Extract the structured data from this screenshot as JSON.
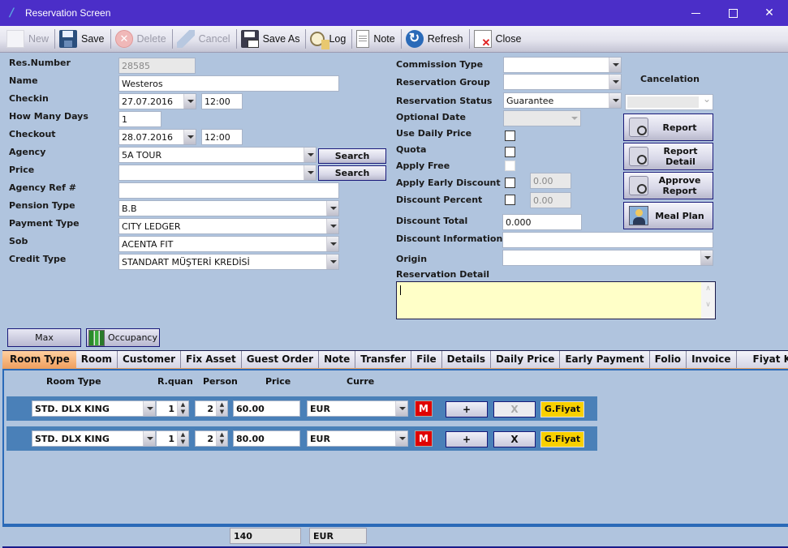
{
  "window": {
    "title": "Reservation Screen",
    "controls": {
      "minimize": "minimize",
      "maximize": "maximize",
      "close": "close"
    }
  },
  "toolbar": {
    "buttons": [
      {
        "label": "New",
        "icon": "new-document-icon",
        "enabled": false
      },
      {
        "label": "Save",
        "icon": "floppy-disk-icon",
        "enabled": true
      },
      {
        "label": "Delete",
        "icon": "delete-circle-icon",
        "enabled": false
      },
      {
        "label": "Cancel",
        "icon": "cancel-icon",
        "enabled": false
      },
      {
        "label": "Save As",
        "icon": "save-as-icon",
        "enabled": true
      },
      {
        "label": "Log",
        "icon": "clock-scroll-icon",
        "enabled": true
      },
      {
        "label": "Note",
        "icon": "notepad-icon",
        "enabled": true
      },
      {
        "label": "Refresh",
        "icon": "refresh-icon",
        "enabled": true
      },
      {
        "label": "Close",
        "icon": "close-window-icon",
        "enabled": true
      }
    ]
  },
  "left_form": {
    "res_number": {
      "label": "Res.Number",
      "value": "28585"
    },
    "name": {
      "label": "Name",
      "value": "Westeros"
    },
    "checkin": {
      "label": "Checkin",
      "date": "27.07.2016",
      "time": "12:00"
    },
    "how_many_days": {
      "label": "How Many Days",
      "value": "1"
    },
    "checkout": {
      "label": "Checkout",
      "date": "28.07.2016",
      "time": "12:00"
    },
    "agency": {
      "label": "Agency",
      "value": "5A TOUR",
      "search_label": "Search"
    },
    "price": {
      "label": "Price",
      "value": "",
      "search_label": "Search"
    },
    "agency_ref": {
      "label": "Agency Ref #",
      "value": ""
    },
    "pension_type": {
      "label": "Pension Type",
      "value": "B.B"
    },
    "payment_type": {
      "label": "Payment Type",
      "value": "CITY LEDGER"
    },
    "sob": {
      "label": "Sob",
      "value": "ACENTA FIT"
    },
    "credit_type": {
      "label": "Credit Type",
      "value": "STANDART MÜŞTERİ KREDİSİ"
    }
  },
  "right_form": {
    "commission_type": {
      "label": "Commission Type",
      "value": ""
    },
    "reservation_group": {
      "label": "Reservation Group",
      "value": ""
    },
    "reservation_status": {
      "label": "Reservation Status",
      "value": "Guarantee"
    },
    "cancelation": {
      "label": "Cancelation",
      "value": ""
    },
    "optional_date": {
      "label": "Optional Date",
      "value": ""
    },
    "use_daily_price": {
      "label": "Use Daily Price",
      "checked": false
    },
    "quota": {
      "label": "Quota",
      "checked": false
    },
    "apply_free": {
      "label": "Apply Free",
      "checked": false
    },
    "apply_early_discount": {
      "label": "Apply Early Discount",
      "checked": false,
      "value": "0.00"
    },
    "discount_percent": {
      "label": "Discount Percent",
      "checked": false,
      "value": "0.00"
    },
    "discount_total": {
      "label": "Discount Total",
      "value": "0.000"
    },
    "discount_information": {
      "label": "Discount Information",
      "value": ""
    },
    "origin": {
      "label": "Origin",
      "value": ""
    },
    "reservation_detail": {
      "label": "Reservation Detail",
      "value": ""
    }
  },
  "side_buttons": {
    "report": "Report",
    "report_detail": "Report Detail",
    "approve_report_line1": "Approve",
    "approve_report_line2": "Report",
    "meal_plan": "Meal Plan"
  },
  "under_buttons": {
    "max": "Max",
    "occupancy": "Occupancy"
  },
  "tabs": [
    {
      "label": "Room Type",
      "active": true
    },
    {
      "label": "Room"
    },
    {
      "label": "Customer"
    },
    {
      "label": "Fix Asset"
    },
    {
      "label": "Guest Order"
    },
    {
      "label": "Note"
    },
    {
      "label": "Transfer"
    },
    {
      "label": "File"
    },
    {
      "label": "Details"
    },
    {
      "label": "Daily Price"
    },
    {
      "label": "Early Payment"
    },
    {
      "label": "Folio"
    },
    {
      "label": "Invoice"
    },
    {
      "label": "Fiyat Kontrol"
    }
  ],
  "room_grid": {
    "columns": [
      "Room Type",
      "R.quan",
      "Person",
      "Price",
      "Curre"
    ],
    "rows": [
      {
        "room_type": "STD. DLX KING",
        "r_quan": "1",
        "person": "2",
        "price": "60.00",
        "currency": "EUR",
        "m": "M",
        "add": "+",
        "remove": "X",
        "remove_enabled": false,
        "g_fiyat": "G.Fiyat"
      },
      {
        "room_type": "STD. DLX KING",
        "r_quan": "1",
        "person": "2",
        "price": "80.00",
        "currency": "EUR",
        "m": "M",
        "add": "+",
        "remove": "X",
        "remove_enabled": true,
        "g_fiyat": "G.Fiyat"
      }
    ]
  },
  "totals": {
    "amount": "140",
    "currency": "EUR"
  }
}
